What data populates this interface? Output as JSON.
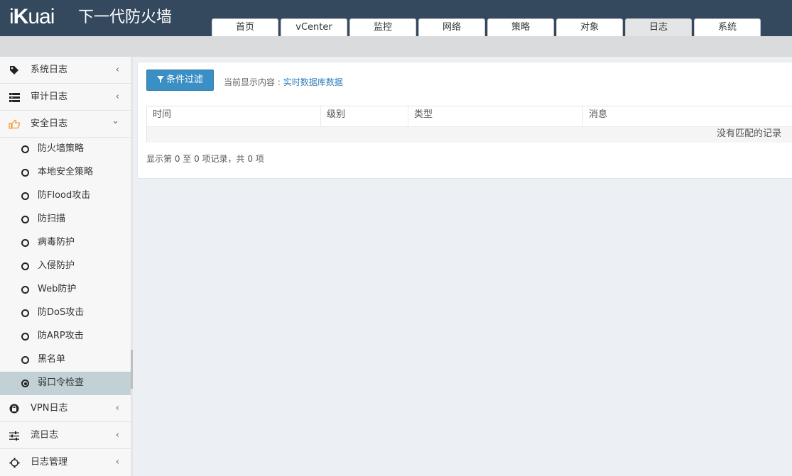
{
  "header": {
    "logo": {
      "i": "i",
      "k": "K",
      "uai": "uai"
    },
    "product_title": "下一代防火墙",
    "tabs": [
      {
        "label": "首页"
      },
      {
        "label": "vCenter"
      },
      {
        "label": "监控"
      },
      {
        "label": "网络"
      },
      {
        "label": "策略"
      },
      {
        "label": "对象"
      },
      {
        "label": "日志"
      },
      {
        "label": "系统"
      }
    ],
    "active_tab": "日志"
  },
  "sidebar": {
    "groups": [
      {
        "label": "系统日志",
        "icon": "tag-icon",
        "arrow": "‹"
      },
      {
        "label": "审计日志",
        "icon": "list-icon",
        "arrow": "‹"
      },
      {
        "label": "安全日志",
        "icon": "hand-pointer-icon",
        "arrow": "⌄"
      }
    ],
    "security_items": [
      {
        "label": "防火墙策略"
      },
      {
        "label": "本地安全策略"
      },
      {
        "label": "防Flood攻击"
      },
      {
        "label": "防扫描"
      },
      {
        "label": "病毒防护"
      },
      {
        "label": "入侵防护"
      },
      {
        "label": "Web防护"
      },
      {
        "label": "防DoS攻击"
      },
      {
        "label": "防ARP攻击"
      },
      {
        "label": "黑名单"
      },
      {
        "label": "弱口令检查"
      }
    ],
    "active_item": "弱口令检查",
    "bottom_groups": [
      {
        "label": "VPN日志",
        "icon": "lock-icon",
        "arrow": "‹"
      },
      {
        "label": "流日志",
        "icon": "sliders-icon",
        "arrow": "‹"
      },
      {
        "label": "日志管理",
        "icon": "gear-icon",
        "arrow": "‹"
      }
    ]
  },
  "main": {
    "filter_button": "条件过滤",
    "current_label": "当前显示内容 : ",
    "current_value": "实时数据库数据",
    "columns": [
      "时间",
      "级别",
      "类型",
      "消息"
    ],
    "empty_text": "没有匹配的记录",
    "record_summary": "显示第 0 至 0 项记录，共 0 项"
  },
  "colors": {
    "header_bg": "#34495e",
    "accent_button": "#3a8fc4",
    "link": "#2f7dbb",
    "active_sidebar": "#c2d1d6",
    "security_icon": "#f0a030"
  }
}
